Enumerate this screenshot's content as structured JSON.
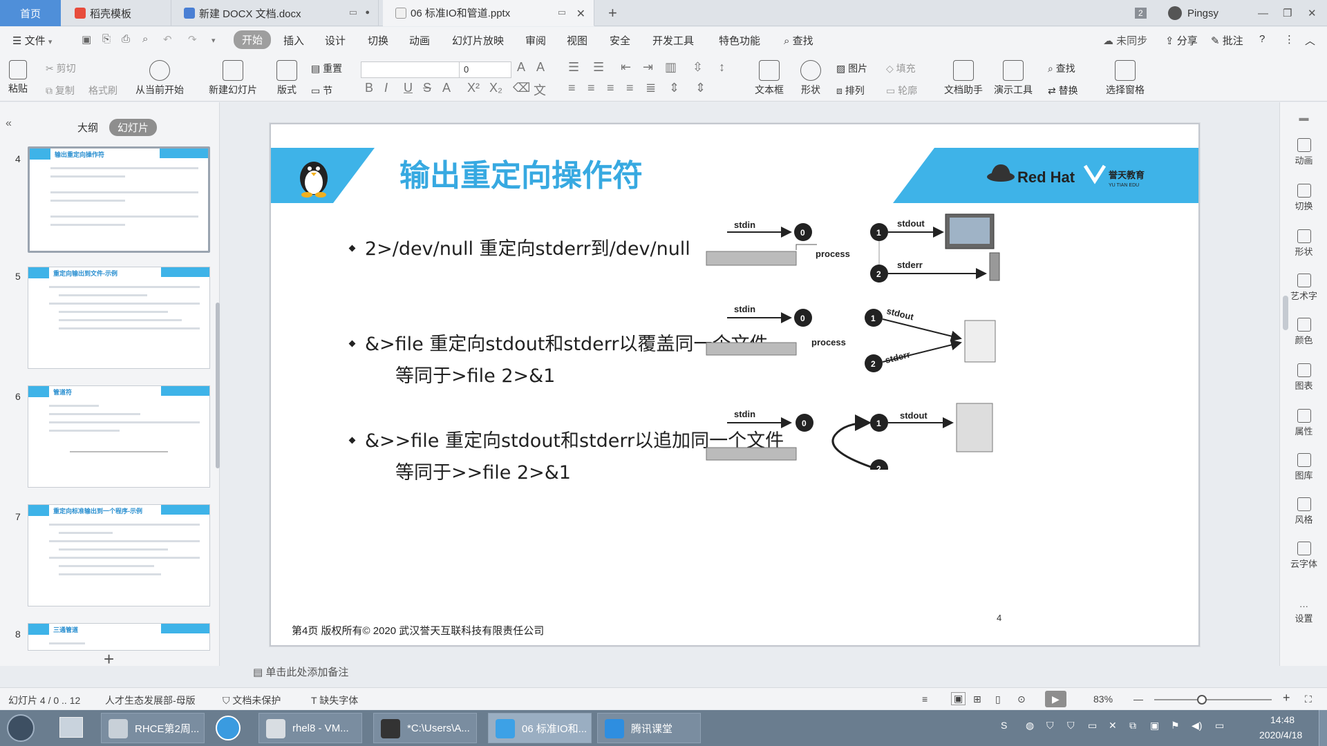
{
  "tabs": {
    "home": "首页",
    "template": "稻壳模板",
    "docx": "新建 DOCX 文档.docx",
    "pptx": "06 标准IO和管道.pptx",
    "page_count_badge": "2",
    "user": "Pingsy"
  },
  "menu": {
    "file": "文件",
    "items": [
      "开始",
      "插入",
      "设计",
      "切换",
      "动画",
      "幻灯片放映",
      "审阅",
      "视图",
      "安全",
      "开发工具",
      "特色功能"
    ],
    "search": "查找",
    "sync": "未同步",
    "share": "分享",
    "comment": "批注"
  },
  "ribbon": {
    "paste": "粘贴",
    "cut": "剪切",
    "copy": "复制",
    "format_painter": "格式刷",
    "from_current": "从当前开始",
    "new_slide": "新建幻灯片",
    "layout": "版式",
    "section": "节",
    "reset": "重置",
    "font_size": "0",
    "textbox": "文本框",
    "shape": "形状",
    "arrange": "排列",
    "picture": "图片",
    "fill": "填充",
    "outline": "轮廓",
    "doc_assistant": "文档助手",
    "presentation_tools": "演示工具",
    "find": "查找",
    "replace": "替换",
    "selection_pane": "选择窗格"
  },
  "left_panel": {
    "outline_tab": "大纲",
    "slides_tab": "幻灯片",
    "thumbnails": [
      {
        "num": "4",
        "title": "输出重定向操作符"
      },
      {
        "num": "5",
        "title": "重定向输出到文件-示例"
      },
      {
        "num": "6",
        "title": "管道符"
      },
      {
        "num": "7",
        "title": "重定向标准输出到一个程序-示例"
      },
      {
        "num": "8",
        "title": "三通管道"
      }
    ],
    "add": "+"
  },
  "slide": {
    "title": "输出重定向操作符",
    "logo_text": "Red Hat",
    "partner_text": "誉天教育",
    "partner_sub": "YU TIAN EDU",
    "bullets": [
      {
        "text": "2>/dev/null 重定向stderr到/dev/null",
        "sub": ""
      },
      {
        "text": "&>file 重定向stdout和stderr以覆盖同一个文件",
        "sub": "等同于>file 2>&1"
      },
      {
        "text": "&>>file 重定向stdout和stderr以追加同一个文件",
        "sub": "等同于>>file 2>&1"
      }
    ],
    "diagram_labels": {
      "stdin": "stdin",
      "stdout": "stdout",
      "stderr": "stderr",
      "process": "process",
      "n0": "0",
      "n1": "1",
      "n2": "2"
    },
    "footer": "第4页        版权所有© 2020 武汉誉天互联科技有限责任公司",
    "page_number": "4"
  },
  "right_sidebar": [
    "动画",
    "切换",
    "形状",
    "艺术字",
    "颜色",
    "图表",
    "属性",
    "图库",
    "风格",
    "云字体",
    "设置"
  ],
  "notes": {
    "placeholder": "单击此处添加备注"
  },
  "status": {
    "slide_count": "幻灯片 4 / 0 .. 12",
    "template": "人才生态发展部-母版",
    "protect": "文档未保护",
    "missing_font": "缺失字体",
    "zoom": "83%"
  },
  "taskbar": {
    "items": [
      "RHCE第2周...",
      "",
      "rhel8 - VM...",
      "*C:\\Users\\A...",
      "06 标准IO和...",
      "腾讯课堂"
    ],
    "time": "14:48",
    "date": "2020/4/18"
  },
  "colors": {
    "accent": "#3eb3e8",
    "title": "#37a9e1",
    "tab_home": "#4f8fd9"
  }
}
